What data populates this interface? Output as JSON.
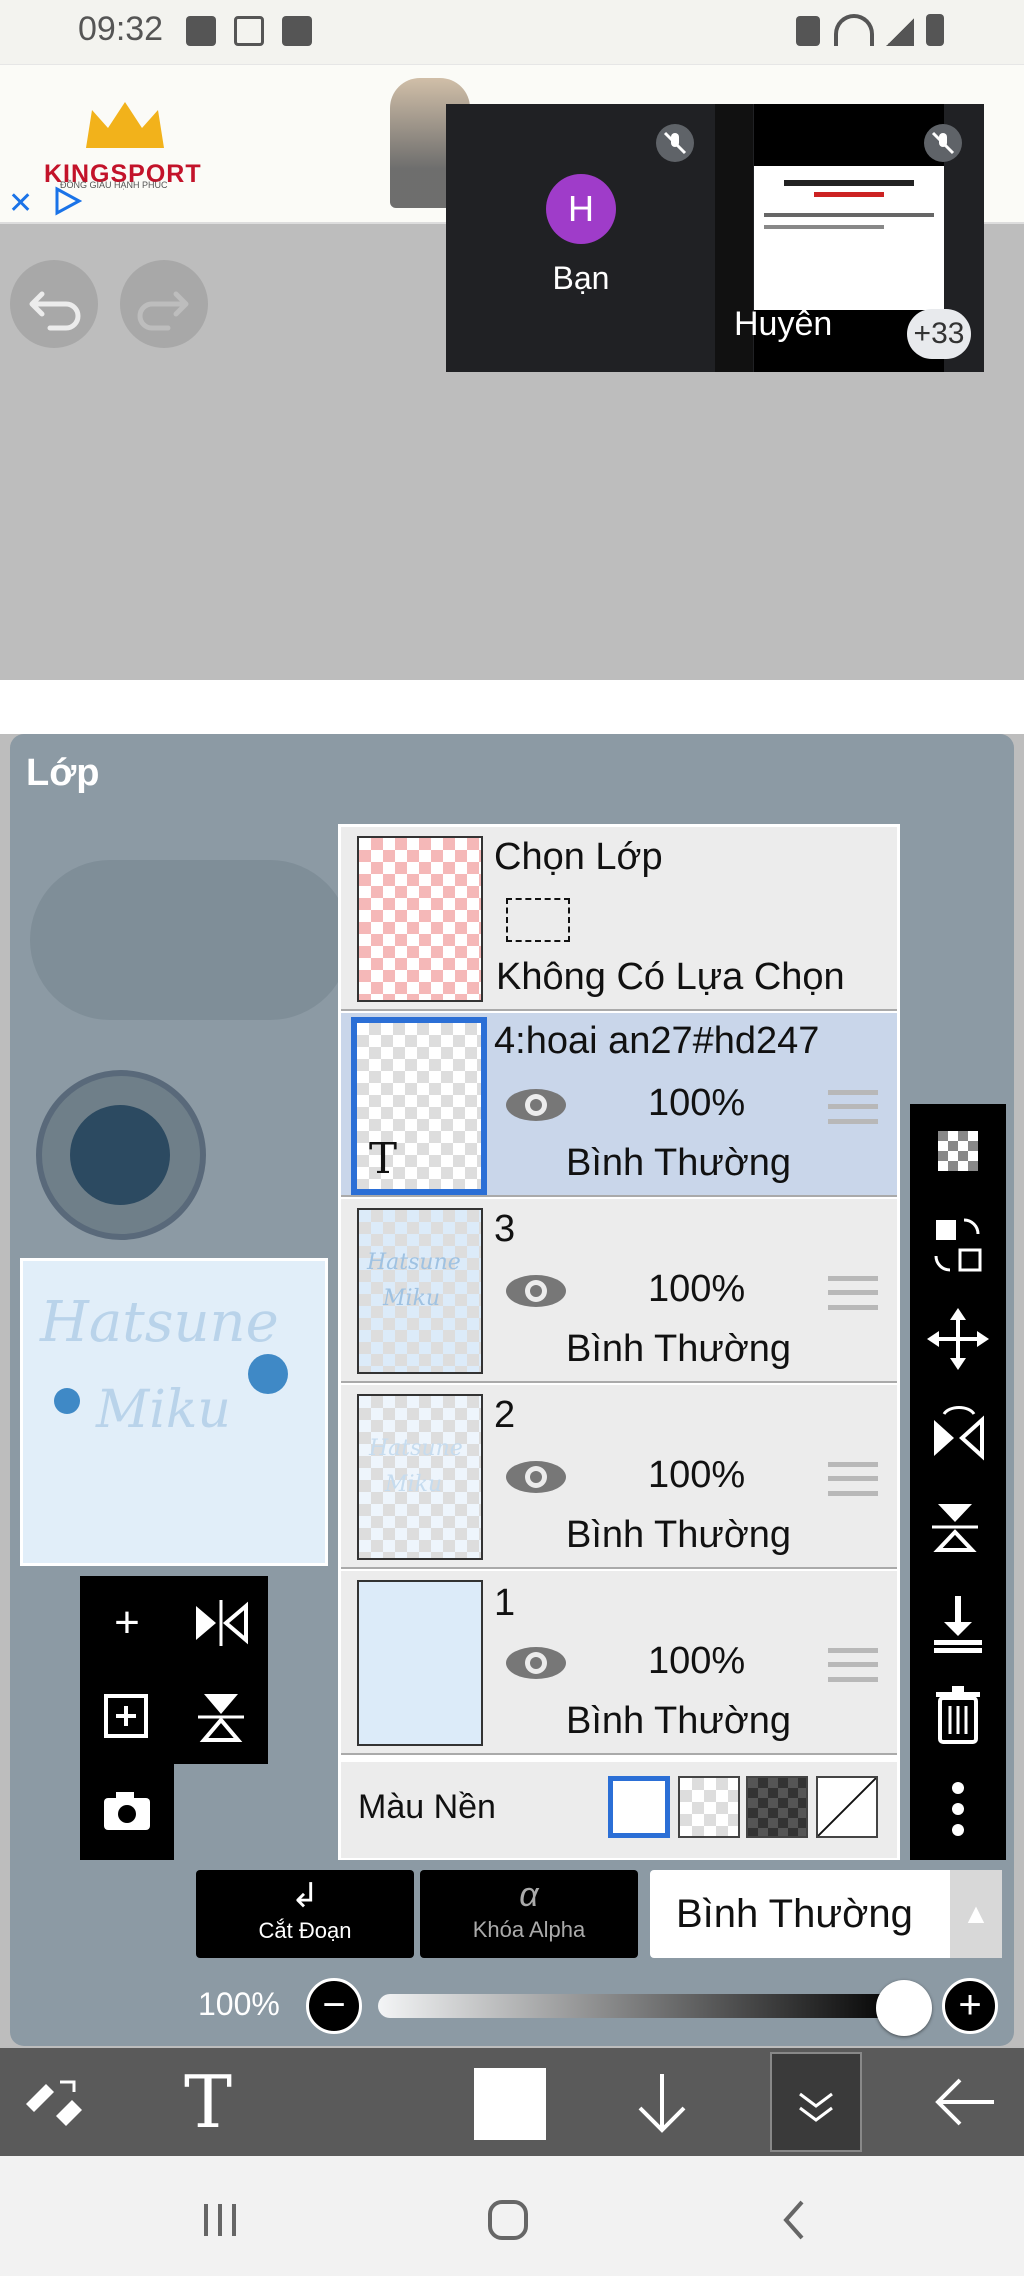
{
  "status_bar": {
    "time": "09:32"
  },
  "ad": {
    "brand": "KINGSPORT",
    "tagline": "ĐỒNG GIÁU HẠNH PHÚC",
    "close_label": "✕"
  },
  "call": {
    "avatar_initial": "H",
    "self_label": "Bạn",
    "presenter_label": "Huyên",
    "participants_more": "+33"
  },
  "canvas": {
    "undo_icon": "undo-icon",
    "redo_icon": "redo-icon"
  },
  "panel": {
    "title": "Lớp",
    "preview_text_line1": "Hatsune",
    "preview_text_line2": "Miku"
  },
  "layers": {
    "select_row": {
      "name": "Chọn Lớp",
      "status": "Không Có Lựa Chọn"
    },
    "items": [
      {
        "name": "4:hoai an27#hd247",
        "opacity": "100%",
        "mode": "Bình Thường",
        "selected": true
      },
      {
        "name": "3",
        "opacity": "100%",
        "mode": "Bình Thường",
        "selected": false
      },
      {
        "name": "2",
        "opacity": "100%",
        "mode": "Bình Thường",
        "selected": false
      },
      {
        "name": "1",
        "opacity": "100%",
        "mode": "Bình Thường",
        "selected": false
      }
    ],
    "background_label": "Màu Nền"
  },
  "controls": {
    "clip_label": "Cắt Đoạn",
    "alpha_lock_label": "Khóa Alpha",
    "alpha_icon_glyph": "α",
    "blend_mode": "Bình Thường",
    "opacity_label": "100%",
    "opacity_value": 1.0
  },
  "colors": {
    "selected_border": "#2b6fd6",
    "avatar": "#9f3cc9"
  }
}
